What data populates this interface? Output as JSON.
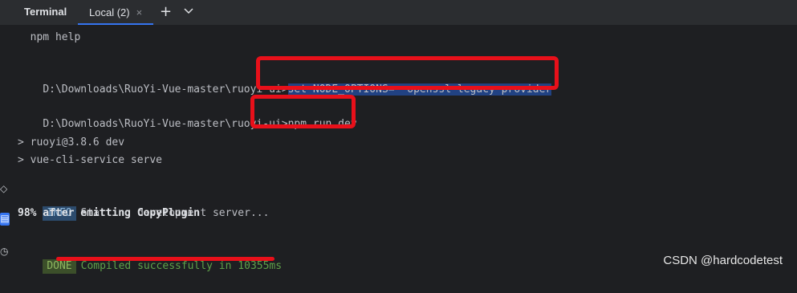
{
  "tabs": {
    "title": "Terminal",
    "local_tab": "Local (2)",
    "close_glyph": "×",
    "add_glyph": "+"
  },
  "left_strip": {
    "icons": [
      "diamond-icon",
      "terminal-icon",
      "clock-icon"
    ]
  },
  "terminal": {
    "line_help": "  npm help",
    "prompt1": "D:\\Downloads\\RuoYi-Vue-master\\ruoyi-ui>",
    "cmd1": "set NODE_OPTIONS=--openssl-legacy-provider",
    "prompt2": "D:\\Downloads\\RuoYi-Vue-master\\ruoyi-ui>",
    "cmd2": "npm run dev",
    "out1": "> ruoyi@3.8.6 dev",
    "out2": "> vue-cli-service serve",
    "info_badge": "INFO",
    "info_text": "Starting development server...",
    "progress": "98% after emitting CopyPlugin",
    "done_badge": "DONE",
    "done_text": "Compiled successfully in 10355ms"
  },
  "watermark": "CSDN @hardcodetest",
  "colors": {
    "background": "#1e1f22",
    "tabbar": "#2b2d30",
    "accent": "#3574f0",
    "annotation_red": "#e8101a",
    "success_green": "#5fa14a"
  }
}
